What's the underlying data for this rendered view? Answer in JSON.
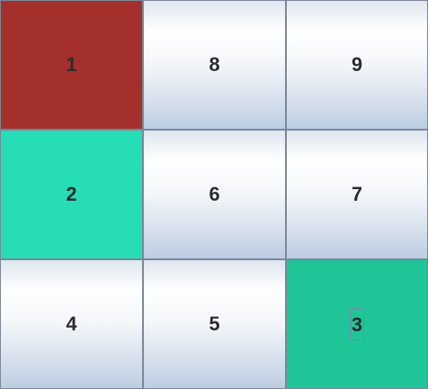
{
  "board": {
    "tiles": [
      {
        "label": "1",
        "color": "#a4302b"
      },
      {
        "label": "8"
      },
      {
        "label": "9"
      },
      {
        "label": "2",
        "color": "#26ddb6"
      },
      {
        "label": "6"
      },
      {
        "label": "7"
      },
      {
        "label": "4"
      },
      {
        "label": "5"
      },
      {
        "label": "3",
        "color": "#1fc598",
        "focused": true
      }
    ]
  }
}
